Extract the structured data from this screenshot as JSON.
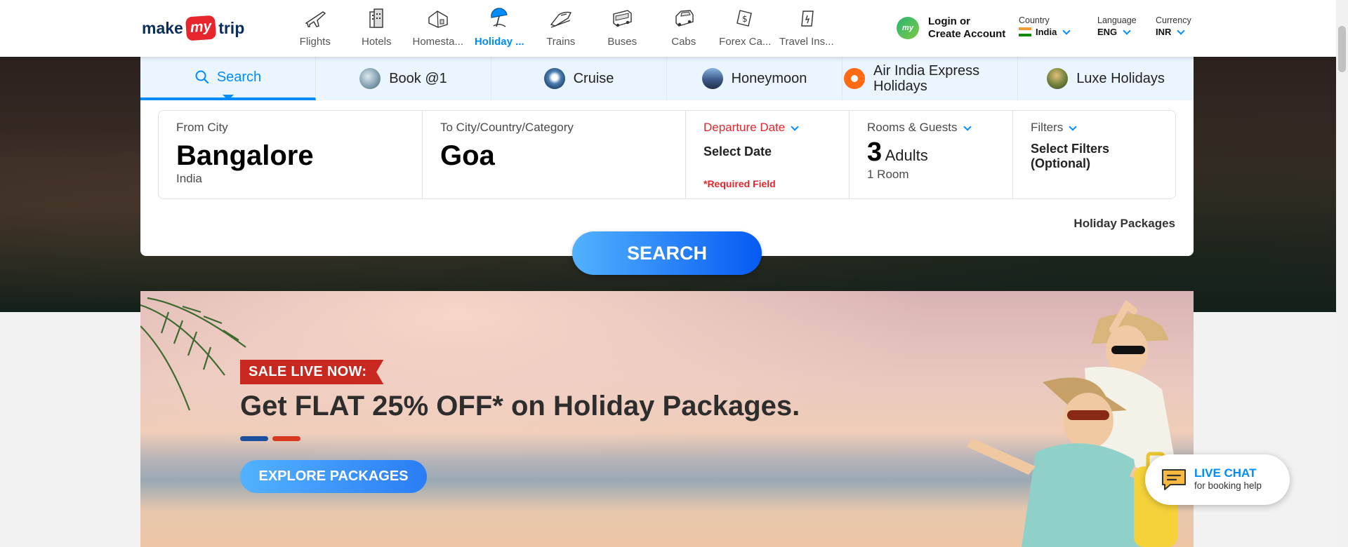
{
  "brand": {
    "part1": "make",
    "part2": "my",
    "part3": "trip"
  },
  "nav": [
    {
      "label": "Flights",
      "icon": "flights-icon"
    },
    {
      "label": "Hotels",
      "icon": "hotels-icon"
    },
    {
      "label": "Homesta...",
      "icon": "homestays-icon"
    },
    {
      "label": "Holiday ...",
      "icon": "holiday-packages-icon",
      "active": true
    },
    {
      "label": "Trains",
      "icon": "trains-icon"
    },
    {
      "label": "Buses",
      "icon": "buses-icon"
    },
    {
      "label": "Cabs",
      "icon": "cabs-icon"
    },
    {
      "label": "Forex Ca...",
      "icon": "forex-card-icon"
    },
    {
      "label": "Travel Ins...",
      "icon": "travel-insurance-icon"
    }
  ],
  "login": {
    "badge": "my",
    "line1": "Login or",
    "line2": "Create Account"
  },
  "prefs": {
    "country": {
      "caption": "Country",
      "value": "India"
    },
    "language": {
      "caption": "Language",
      "value": "ENG"
    },
    "currency": {
      "caption": "Currency",
      "value": "INR"
    }
  },
  "tabs": [
    {
      "label": "Search",
      "icon": "search-icon",
      "active": true
    },
    {
      "label": "Book @1",
      "icon": "book-at-1-icon"
    },
    {
      "label": "Cruise",
      "icon": "cruise-icon"
    },
    {
      "label": "Honeymoon",
      "icon": "honeymoon-icon"
    },
    {
      "label": "Air India Express Holidays",
      "icon": "air-india-express-icon"
    },
    {
      "label": "Luxe Holidays",
      "icon": "luxe-holidays-icon"
    }
  ],
  "search": {
    "from": {
      "caption": "From City",
      "value": "Bangalore",
      "sub": "India"
    },
    "to": {
      "caption": "To City/Country/Category",
      "value": "Goa"
    },
    "date": {
      "caption": "Departure Date",
      "value": "Select Date",
      "required": "*Required Field"
    },
    "rooms": {
      "caption": "Rooms & Guests",
      "count": "3",
      "unit": "Adults",
      "sub": "1 Room"
    },
    "filters": {
      "caption": "Filters",
      "line1": "Select Filters",
      "line2": "(Optional)"
    },
    "packages_label": "Holiday Packages",
    "button": "SEARCH"
  },
  "banner": {
    "sale": "SALE LIVE NOW:",
    "headline": "Get FLAT 25% OFF*  on Holiday Packages.",
    "cta": "EXPLORE PACKAGES"
  },
  "livechat": {
    "title": "LIVE CHAT",
    "subtitle": "for booking help"
  },
  "colors": {
    "accent": "#008cff",
    "brand_red": "#e7252d",
    "dark_blue": "#0a2d5c"
  }
}
